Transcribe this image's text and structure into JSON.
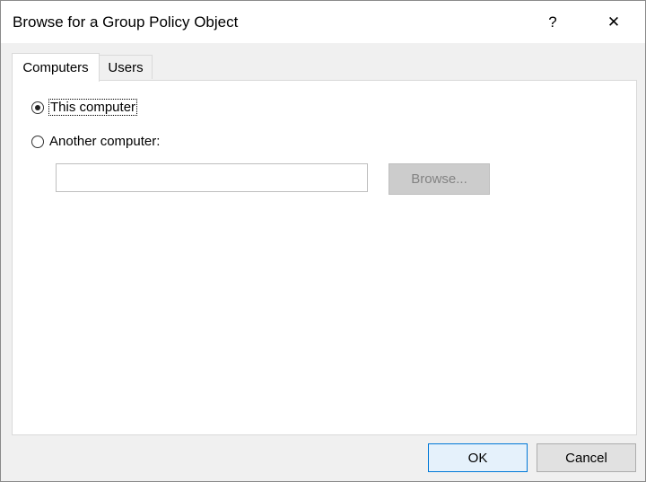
{
  "window": {
    "title": "Browse for a Group Policy Object",
    "help_glyph": "?",
    "close_glyph": "✕"
  },
  "tabs": [
    {
      "label": "Computers",
      "active": true
    },
    {
      "label": "Users",
      "active": false
    }
  ],
  "computers": {
    "options": [
      {
        "label": "This computer",
        "checked": true
      },
      {
        "label": "Another computer:",
        "checked": false
      }
    ],
    "computer_name": {
      "value": "",
      "placeholder": ""
    },
    "browse_label": "Browse..."
  },
  "buttons": {
    "ok_label": "OK",
    "cancel_label": "Cancel"
  },
  "colors": {
    "accent": "#0078d7",
    "dialog_bg": "#f0f0f0",
    "disabled_text": "#838383"
  }
}
